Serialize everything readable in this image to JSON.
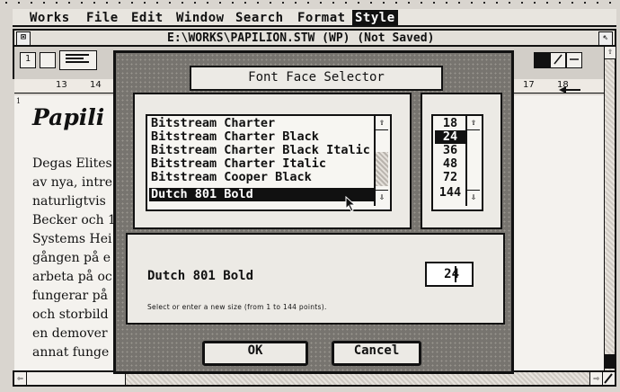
{
  "menu": [
    "Works",
    "File",
    "Edit",
    "Window",
    "Search",
    "Format",
    "Style"
  ],
  "active_menu": "Style",
  "window": {
    "title": "E:\\WORKS\\PAPILION.STW (WP) (Not Saved)",
    "close_glyph": "⊠",
    "full_glyph": "⇖"
  },
  "toolbar": {
    "first_button": "1"
  },
  "ruler": {
    "marks": [
      "13",
      "14",
      "17",
      "18"
    ]
  },
  "document": {
    "heading": "Papili",
    "lines": [
      "Degas Elites",
      "av nya, intre",
      "naturligtvis",
      "Becker och 1",
      "Systems Hei",
      "gången på e",
      "arbeta på oc",
      "fungerar på",
      "och storbild",
      "en demover",
      "annat funge"
    ]
  },
  "dialog": {
    "title": "Font Face Selector",
    "fonts": [
      "Bitstream Charter",
      "Bitstream Charter Black",
      "Bitstream Charter Black Italic",
      "Bitstream Charter Italic",
      "Bitstream Cooper Black",
      "Dutch 801 Bold"
    ],
    "selected_font": "Dutch 801 Bold",
    "sizes": [
      "18",
      "24",
      "36",
      "48",
      "72",
      "144"
    ],
    "selected_size": "24",
    "sample_font_name": "Dutch 801 Bold",
    "size_value": "24",
    "hint": "Select or enter a new size (from 1 to 144 points).",
    "ok_label": "OK",
    "cancel_label": "Cancel"
  },
  "scroll_up_glyph": "⇧",
  "scroll_down_glyph": "⇩",
  "scroll_left_glyph": "⇦",
  "scroll_right_glyph": "⇨"
}
